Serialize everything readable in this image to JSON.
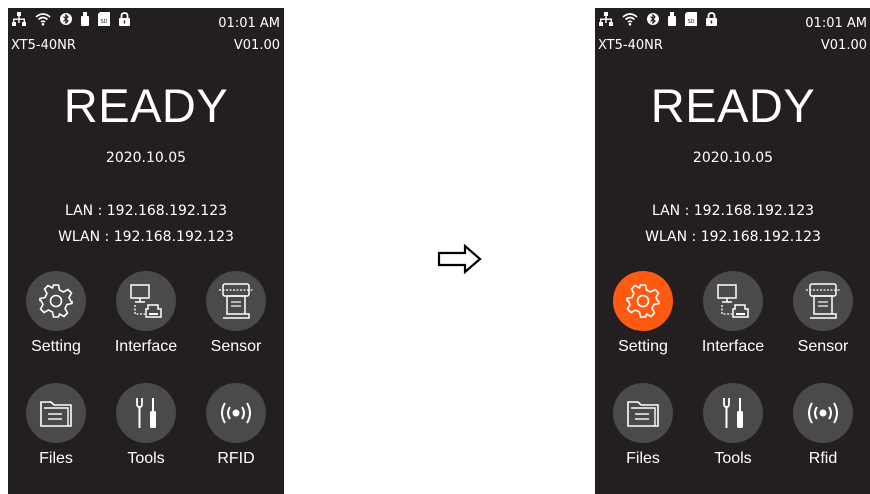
{
  "colors": {
    "screen_bg": "#231f20",
    "tile_bg": "#4a4a4a",
    "active_tile_bg": "#ff5a12",
    "text": "#ffffff"
  },
  "arrow_icon": "right-arrow-icon",
  "before": {
    "status_icons": [
      "lan-icon",
      "wifi-icon",
      "bluetooth-icon",
      "usb-icon",
      "sd-card-icon",
      "lock-icon"
    ],
    "sd_label": "SD",
    "time": "01:01 AM",
    "model": "XT5-40NR",
    "version": "V01.00",
    "state": "READY",
    "date": "2020.10.05",
    "lan": "LAN : 192.168.192.123",
    "wlan": "WLAN : 192.168.192.123",
    "menu": [
      {
        "label": "Setting",
        "icon": "gear-icon"
      },
      {
        "label": "Interface",
        "icon": "interface-icon"
      },
      {
        "label": "Sensor",
        "icon": "sensor-icon"
      },
      {
        "label": "Files",
        "icon": "folder-icon"
      },
      {
        "label": "Tools",
        "icon": "tools-icon"
      },
      {
        "label": "RFID",
        "icon": "rfid-icon"
      }
    ]
  },
  "after": {
    "status_icons": [
      "lan-icon",
      "wifi-icon",
      "bluetooth-icon",
      "usb-icon",
      "sd-card-icon",
      "lock-icon"
    ],
    "sd_label": "SD",
    "time": "01:01 AM",
    "model": "XT5-40NR",
    "version": "V01.00",
    "state": "READY",
    "date": "2020.10.05",
    "lan": "LAN : 192.168.192.123",
    "wlan": "WLAN : 192.168.192.123",
    "selected": "Setting",
    "menu": [
      {
        "label": "Setting",
        "icon": "gear-icon"
      },
      {
        "label": "Interface",
        "icon": "interface-icon"
      },
      {
        "label": "Sensor",
        "icon": "sensor-icon"
      },
      {
        "label": "Files",
        "icon": "folder-icon"
      },
      {
        "label": "Tools",
        "icon": "tools-icon"
      },
      {
        "label": "Rfid",
        "icon": "rfid-icon"
      }
    ]
  }
}
